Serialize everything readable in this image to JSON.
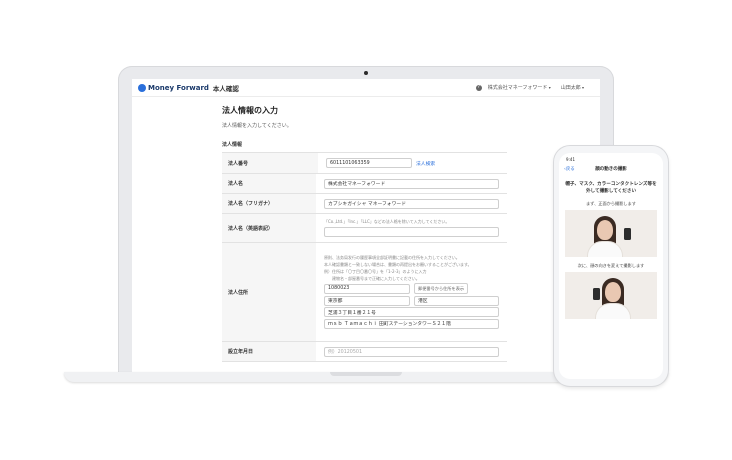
{
  "app": {
    "logo_text": "Money Forward",
    "logo_sub": "本人確認",
    "company_menu": "株式会社マネーフォワード",
    "user_menu": "山田太郎",
    "help_icon": "?"
  },
  "form": {
    "title": "法人情報の入力",
    "subtitle": "法人情報を入力してください。",
    "section": "法人情報",
    "corp_number": {
      "label": "法人番号",
      "value": "6011101063359",
      "link": "法人検索"
    },
    "corp_name": {
      "label": "法人名",
      "value": "株式会社マネーフォワード"
    },
    "corp_kana": {
      "label": "法人名（フリガナ）",
      "value": "カブシキガイシャ マネーフォワード"
    },
    "corp_en": {
      "label": "法人名（英語表記）",
      "note": "「Co.,Ltd.」「Inc.」「LLC」などの法人格を除いて入力してください。"
    },
    "address": {
      "label": "法人住所",
      "note1": "原則、法务局发行の履歴事項全部証明書に記載の住所を入力してください。",
      "note2": "本人確認書類と一致しない場合は、書類の再提出をお願いすることがございます。",
      "note3": "例）住所は「〇丁目〇番〇号」を「1-2-3」のように入力",
      "note4": "　　建物名・部屋番号まで正確に入力してください。",
      "zip": "1080023",
      "zip_button": "郵便番号から住所を表示",
      "prefecture": "東京都",
      "city": "港区",
      "street": "芝浦３丁目１番２１号",
      "building": "ｍｓｂ Ｔａｍａｃｈｉ 田町ステーションタワーＳ２１階"
    },
    "founded": {
      "label": "設立年月日",
      "placeholder": "例）20120501"
    }
  },
  "phone": {
    "time": "9:41",
    "back_label": "戻る",
    "title": "顔の動きの撮影",
    "instruction_line1": "帽子、マスク、カラーコンタクトレンズ等を",
    "instruction_line2": "外して撮影してください",
    "caption1": "まず、正面から撮影します",
    "caption2": "次に、顔の向きを変えて撮影します"
  },
  "colors": {
    "accent": "#2a6fdb",
    "brand": "#1b3a6b"
  }
}
